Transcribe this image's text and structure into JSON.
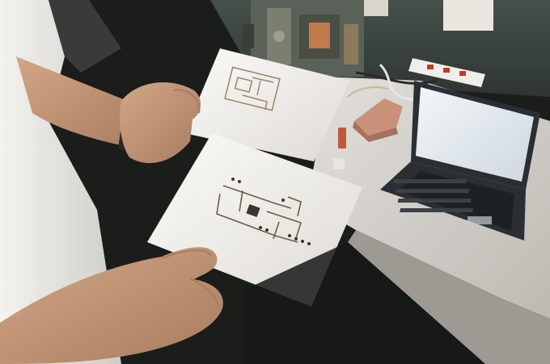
{
  "scene": {
    "colors": {
      "background": "#1b1d1b",
      "wall": "#3f4a45",
      "table": "#d9d7d2",
      "shirt": "#ecebe8",
      "skin": "#c99c7c",
      "skin_shadow": "#a97c5f",
      "paper": "#f4f2ee",
      "paper_shadow": "#d6d3cd",
      "trace": "#7d6a55",
      "trace_dark": "#3e3429",
      "laptop_body": "#2b2f33",
      "laptop_screen": "#e9eef2",
      "eraser": "#c9907a"
    },
    "objects": [
      "person-arm",
      "left-hand",
      "right-hand",
      "circuit-paper-top",
      "circuit-paper-bottom",
      "laptop",
      "electronics-rig",
      "power-strip",
      "eraser",
      "cables"
    ]
  }
}
